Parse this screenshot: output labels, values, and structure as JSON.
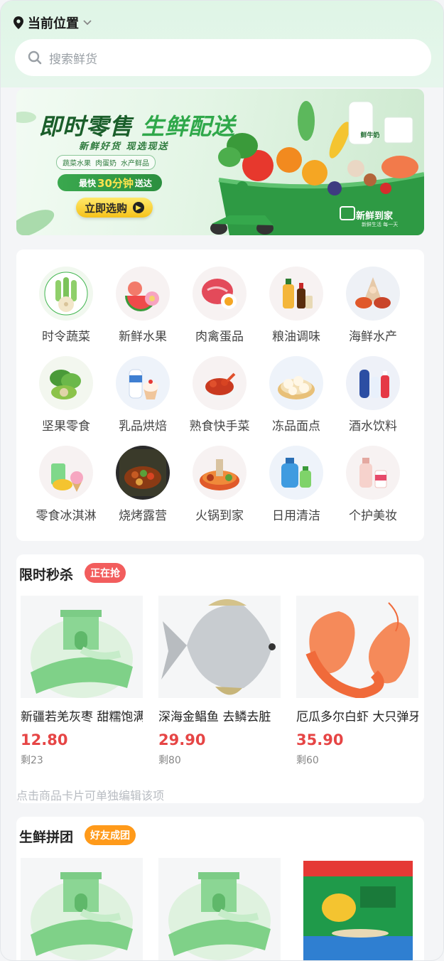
{
  "header": {
    "location_label": "当前位置",
    "search_placeholder": "搜索鲜货"
  },
  "banner": {
    "title_part1": "即时零售",
    "title_part2": "生鲜配送",
    "subtitle": "新鲜好货 现选现送",
    "tags": [
      "蔬菜水果",
      "肉蛋奶",
      "水产鲜品"
    ],
    "fast_prefix": "最快",
    "fast_number": "30分钟",
    "fast_suffix": "送达",
    "cta": "立即选购",
    "milk_label": "鲜牛奶",
    "brand": "新鲜到家",
    "brand_slogan": "新鲜生活 每一天"
  },
  "categories": [
    {
      "label": "时令蔬菜",
      "icon": "vegetable-icon"
    },
    {
      "label": "新鲜水果",
      "icon": "fruit-icon"
    },
    {
      "label": "肉禽蛋品",
      "icon": "meat-icon"
    },
    {
      "label": "粮油调味",
      "icon": "oil-icon"
    },
    {
      "label": "海鲜水产",
      "icon": "seafood-icon"
    },
    {
      "label": "坚果零食",
      "icon": "nuts-icon"
    },
    {
      "label": "乳品烘焙",
      "icon": "dairy-icon"
    },
    {
      "label": "熟食快手菜",
      "icon": "deli-icon"
    },
    {
      "label": "冻品面点",
      "icon": "frozen-icon"
    },
    {
      "label": "酒水饮料",
      "icon": "drinks-icon"
    },
    {
      "label": "零食冰淇淋",
      "icon": "icecream-icon"
    },
    {
      "label": "烧烤露营",
      "icon": "bbq-icon"
    },
    {
      "label": "火锅到家",
      "icon": "hotpot-icon"
    },
    {
      "label": "日用清洁",
      "icon": "cleaning-icon"
    },
    {
      "label": "个护美妆",
      "icon": "beauty-icon"
    }
  ],
  "flash_sale": {
    "title": "限时秒杀",
    "badge": "正在抢",
    "badge_color": "#f25d5d",
    "products": [
      {
        "name": "新疆若羌灰枣 甜糯饱满",
        "price": "12.80",
        "stock": "剩23"
      },
      {
        "name": "深海金鲳鱼 去鳞去脏",
        "price": "29.90",
        "stock": "剩80"
      },
      {
        "name": "厄瓜多尔白虾 大只弹牙",
        "price": "35.90",
        "stock": "剩60"
      }
    ],
    "hint": "点击商品卡片可单独编辑该项"
  },
  "group_buy": {
    "title": "生鲜拼团",
    "badge": "好友成团",
    "badge_color": "#ff9a1a"
  },
  "colors": {
    "header_bg": "#dff5e6",
    "price": "#e64545",
    "accent_green": "#2fa84a"
  }
}
